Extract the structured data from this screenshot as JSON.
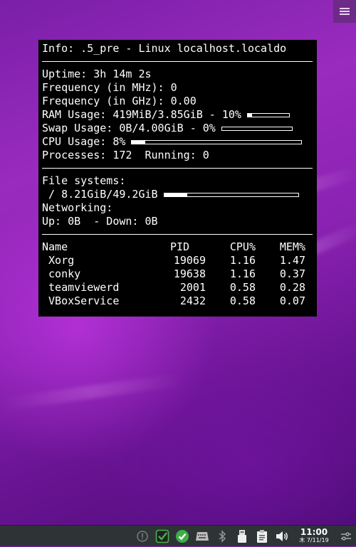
{
  "conky": {
    "info": "Info: .5_pre - Linux localhost.localdo",
    "uptime": "Uptime: 3h 14m 2s",
    "freq_mhz": "Frequency (in MHz): 0",
    "freq_ghz": "Frequency (in GHz): 0.00",
    "ram": "RAM Usage: 419MiB/3.85GiB - 10%",
    "ram_pct": 10,
    "swap": "Swap Usage: 0B/4.00GiB - 0%",
    "swap_pct": 0,
    "cpu": "CPU Usage: 8%",
    "cpu_pct": 8,
    "processes": "Processes: 172  Running: 0",
    "fs_header": "File systems:",
    "fs_root": " / 8.21GiB/49.2GiB",
    "fs_pct": 17,
    "net_header": "Networking:",
    "net": "Up: 0B  - Down: 0B",
    "table_headers": {
      "name": "Name",
      "pid": "PID",
      "cpu": "CPU%",
      "mem": "MEM%"
    },
    "processes_list": [
      {
        "name": " Xorg",
        "pid": "19069",
        "cpu": "1.16",
        "mem": "1.47"
      },
      {
        "name": " conky",
        "pid": "19638",
        "cpu": "1.16",
        "mem": "0.37"
      },
      {
        "name": " teamviewerd",
        "pid": "2001",
        "cpu": "0.58",
        "mem": "0.28"
      },
      {
        "name": " VBoxService",
        "pid": "2432",
        "cpu": "0.58",
        "mem": "0.07"
      }
    ]
  },
  "taskbar": {
    "clock_time": "11:00",
    "clock_date": "木 7/11/19",
    "tray_icons": [
      "alert-icon",
      "task-check-icon",
      "check-circle-icon",
      "keyboard-icon",
      "bluetooth-icon",
      "usb-icon",
      "clipboard-icon",
      "volume-icon",
      "settings-sliders-icon"
    ]
  },
  "colors": {
    "panel_bg": "#000000",
    "taskbar_bg": "#2e3436",
    "wallpaper": "#8b22b3"
  }
}
